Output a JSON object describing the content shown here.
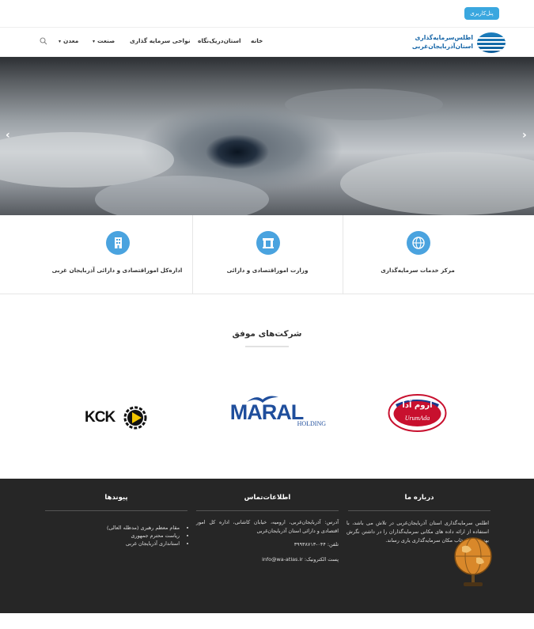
{
  "topbar": {
    "panel_label": "پنل‌کاربری"
  },
  "logo": {
    "line1": "اطلس‌سرمایه‌گذاری",
    "line2": "استان‌آذربایجان‌غربی"
  },
  "nav": {
    "items": [
      {
        "label": "خانه"
      },
      {
        "label": "استان‌در‌یک‌نگاه"
      },
      {
        "label": "نواحی سرمایه گذاری"
      },
      {
        "label": "صنعت"
      },
      {
        "label": "معدن"
      }
    ],
    "search_icon": "search-icon"
  },
  "hero": {
    "prev_icon": "chevron-left-icon",
    "next_icon": "chevron-right-icon"
  },
  "features": [
    {
      "label": "مرکز خدمات سرمایه‌گذاری",
      "icon": "globe-icon"
    },
    {
      "label": "وزارت اموراقتصادی و دارائی",
      "icon": "building-gate-icon"
    },
    {
      "label": "اداره‌کل اموراقتصادی و دارائی آذربایجان غربی",
      "icon": "office-building-icon"
    }
  ],
  "partners": {
    "title": "شرکت‌های موفق",
    "logos": [
      {
        "name": "urumada-logo",
        "text_fa": "اروم آدا",
        "text_en": "UrumAda"
      },
      {
        "name": "maral-logo",
        "text": "MARAL",
        "sub": "HOLDING"
      },
      {
        "name": "kck-logo",
        "text": "KCK"
      }
    ]
  },
  "footer": {
    "about": {
      "title": "درباره ما",
      "text": "اطلس سرمایه‌گذاری استان آذربایجان‌غربی در تلاش می باشد، با استفاده از ارائه داده های مکانی سرمایه‌گذاران را در داشتن نگرش بهتر برای انتخاب مکان سرمایه‌گذاری یاری رساند."
    },
    "contact": {
      "title": "اطلاعات‌تماس",
      "address": "آدرس: آذربایجان‌غربی، ارومیه، خیابان کاشانی، اداره کل امور اقتصادی و دارائی استان آذربایجان‌غربی",
      "phone": "تلفن: ۰۴۴-۳۹۹۳۸۷۱۳",
      "email": "پست الکترونیک: info@wa-atlas.ir"
    },
    "links": {
      "title": "پیوندها",
      "items": [
        "مقام معظم رهبری (مدظله العالی)",
        "ریاست محترم جمهوری",
        "استانداری آذربایجان غربی"
      ]
    }
  },
  "colors": {
    "accent": "#3aa7df",
    "icon_bg": "#4aa3df",
    "footer_bg": "#262626",
    "logo_blue": "#1565a7"
  }
}
